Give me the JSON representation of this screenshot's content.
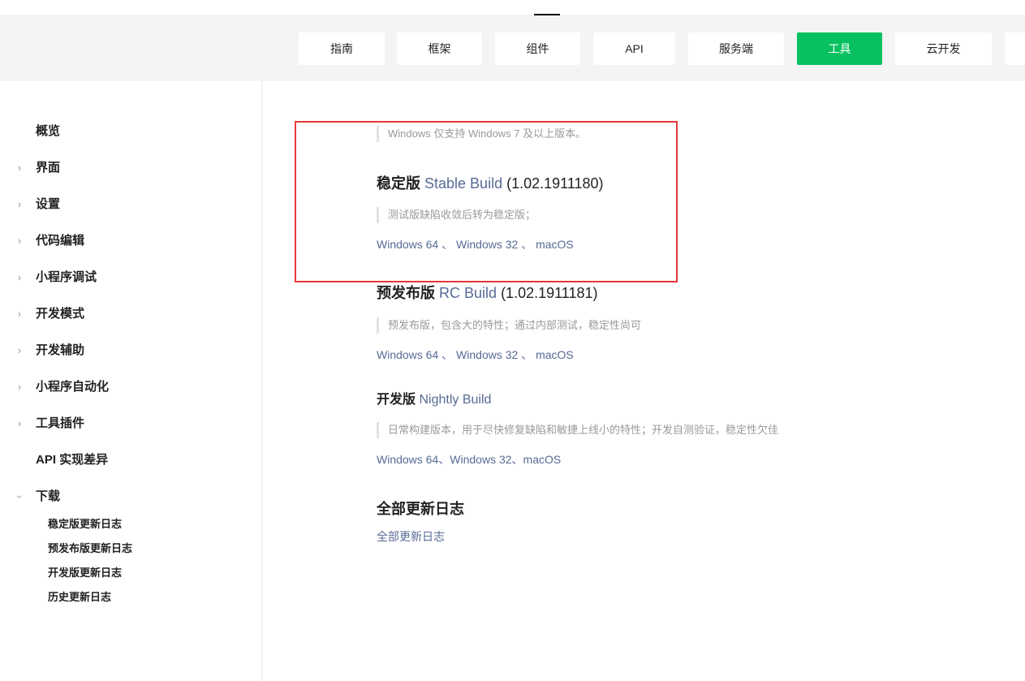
{
  "nav": {
    "tabs": [
      {
        "label": "指南"
      },
      {
        "label": "框架"
      },
      {
        "label": "组件"
      },
      {
        "label": "API"
      },
      {
        "label": "服务端"
      },
      {
        "label": "工具",
        "active": true
      },
      {
        "label": "云开发"
      }
    ]
  },
  "sidebar": {
    "items": [
      {
        "label": "概览"
      },
      {
        "label": "界面"
      },
      {
        "label": "设置"
      },
      {
        "label": "代码编辑"
      },
      {
        "label": "小程序调试"
      },
      {
        "label": "开发模式"
      },
      {
        "label": "开发辅助"
      },
      {
        "label": "小程序自动化"
      },
      {
        "label": "工具插件"
      },
      {
        "label": "API 实现差异"
      },
      {
        "label": "下载"
      }
    ],
    "sub_items": [
      {
        "label": "稳定版更新日志"
      },
      {
        "label": "预发布版更新日志"
      },
      {
        "label": "开发版更新日志"
      },
      {
        "label": "历史更新日志"
      }
    ]
  },
  "main": {
    "windows_note": "Windows 仅支持 Windows 7 及以上版本。",
    "stable": {
      "title_prefix": "稳定版",
      "title_link": "Stable Build",
      "version": "(1.02.1911180)",
      "desc": "测试版缺陷收敛后转为稳定版；",
      "links": [
        "Windows 64",
        "Windows 32",
        "macOS"
      ],
      "sep": " 、 "
    },
    "rc": {
      "title_prefix": "预发布版",
      "title_link": "RC Build",
      "version": "(1.02.1911181)",
      "desc": "预发布版，包含大的特性；通过内部测试，稳定性尚可",
      "links": [
        "Windows 64",
        "Windows 32",
        "macOS"
      ],
      "sep": " 、 "
    },
    "nightly": {
      "title_prefix": "开发版",
      "title_link": "Nightly Build",
      "desc": "日常构建版本，用于尽快修复缺陷和敏捷上线小的特性；开发自测验证，稳定性欠佳",
      "links": [
        "Windows 64",
        "Windows 32",
        "macOS"
      ],
      "sep": "、"
    },
    "changelog": {
      "title": "全部更新日志",
      "link": "全部更新日志"
    }
  },
  "colors": {
    "accent": "#07c160",
    "link": "#576b95",
    "highlight": "#e8373c"
  }
}
